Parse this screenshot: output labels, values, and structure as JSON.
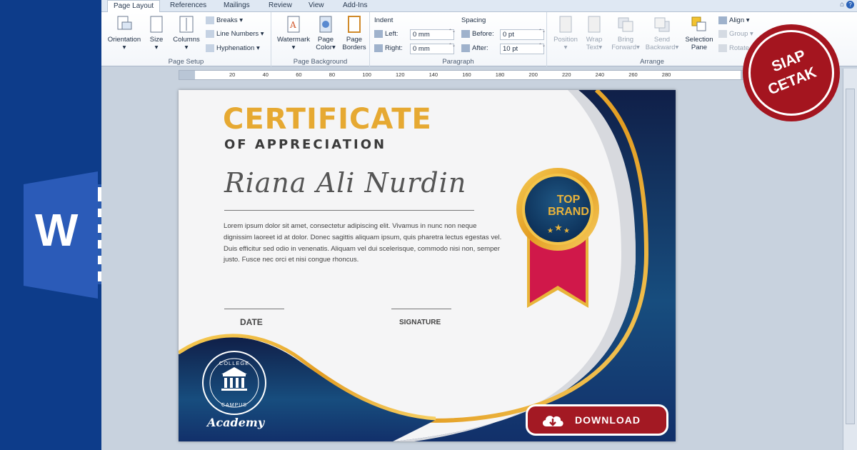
{
  "tabs": [
    "Page Layout",
    "References",
    "Mailings",
    "Review",
    "View",
    "Add-Ins"
  ],
  "ribbon": {
    "page_setup": {
      "title": "Page Setup",
      "orientation": "Orientation",
      "size": "Size",
      "columns": "Columns",
      "breaks": "Breaks",
      "line_numbers": "Line Numbers",
      "hyphenation": "Hyphenation"
    },
    "page_background": {
      "title": "Page Background",
      "watermark": "Watermark",
      "page_color_1": "Page",
      "page_color_2": "Color",
      "page_borders_1": "Page",
      "page_borders_2": "Borders"
    },
    "paragraph": {
      "title": "Paragraph",
      "indent": "Indent",
      "spacing": "Spacing",
      "left_label": "Left:",
      "left_value": "0 mm",
      "right_label": "Right:",
      "right_value": "0 mm",
      "before_label": "Before:",
      "before_value": "0 pt",
      "after_label": "After:",
      "after_value": "10 pt"
    },
    "arrange": {
      "title": "Arrange",
      "position": "Position",
      "wrap_1": "Wrap",
      "wrap_2": "Text",
      "bring_1": "Bring",
      "bring_2": "Forward",
      "send_1": "Send",
      "send_2": "Backward",
      "selection_1": "Selection",
      "selection_2": "Pane",
      "align": "Align",
      "group": "Group",
      "rotate": "Rotate"
    }
  },
  "ruler_labels": [
    "20",
    "40",
    "60",
    "80",
    "100",
    "120",
    "140",
    "160",
    "180",
    "200",
    "220",
    "240",
    "260",
    "280"
  ],
  "certificate": {
    "title": "CERTIFICATE",
    "subtitle": "OF APPRECIATION",
    "name": "Riana Ali Nurdin",
    "body": "Lorem ipsum dolor sit amet, consectetur adipiscing elit. Vivamus in nunc non neque dignissim laoreet id at dolor. Donec sagittis aliquam ipsum, quis pharetra lectus egestas vel. Duis efficitur sed odio in venenatis. Aliquam vel dui scelerisque, commodo nisi non, semper justo. Fusce nec orci et nisi congue rhoncus.",
    "date_label": "DATE",
    "signature_label": "SIGNATURE",
    "badge_line1": "TOP",
    "badge_line2": "BRAND",
    "college_top": "COLLEGE",
    "college_bottom": "CAMPUS",
    "academy": "Academy"
  },
  "download_label": "DOWNLOAD",
  "stamp": {
    "line1": "SIAP",
    "line2": "CETAK"
  },
  "colors": {
    "word_blue": "#0d3c8a",
    "gold": "#e6a932",
    "navy": "#122a5c",
    "red": "#a31923"
  },
  "icons": [
    "word-logo-icon",
    "cloud-download-icon",
    "help-icon",
    "top-brand-medal-icon",
    "college-campus-emblem-icon"
  ]
}
